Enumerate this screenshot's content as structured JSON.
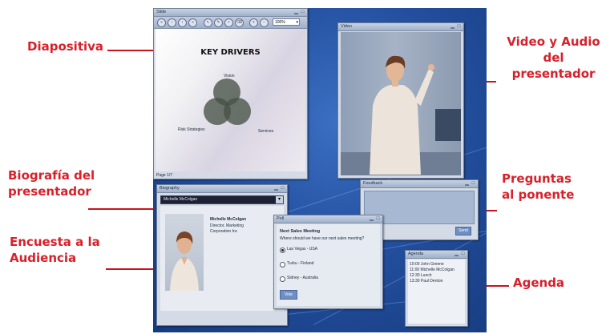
{
  "callouts": {
    "diapositiva": "Diapositiva",
    "video": "Video y Audio\ndel presentador",
    "biografia": "Biografía del\npresentador",
    "preguntas": "Preguntas\nal ponente",
    "encuesta": "Encuesta a la\nAudiencia",
    "agenda": "Agenda"
  },
  "slide_window": {
    "title": "Slide",
    "zoom": "100%",
    "page": "Page 1/7",
    "slide_title": "KEY DRIVERS",
    "venn_top": "Vision",
    "venn_left": "Risk Strategies",
    "venn_right": "Services"
  },
  "video_window": {
    "title": "Video"
  },
  "bio_window": {
    "title": "Biography",
    "selected_presenter": "Michelle McColgan",
    "name": "Michelle McColgan",
    "role": "Director, Marketing",
    "company": "Corporation Inc"
  },
  "poll_window": {
    "title": "Poll",
    "heading": "Next Sales Meeting",
    "question": "Where should we have our next sales meeting?",
    "options": [
      "Las Vegas - USA",
      "Turku - Finland",
      "Sidney - Australia"
    ],
    "submit_label": "Vote"
  },
  "feedback_window": {
    "title": "Feedback",
    "send_label": "Send"
  },
  "agenda_window": {
    "title": "Agenda",
    "items": [
      "10:00 John Greene",
      "11:00 Michelle McColgan",
      "12:30 Lunch",
      "13:30 Paul Denton"
    ]
  },
  "colors": {
    "callout_text": "#d8202a",
    "desktop_blue": "#234f9e",
    "window_chrome": "#d4dbe6"
  }
}
